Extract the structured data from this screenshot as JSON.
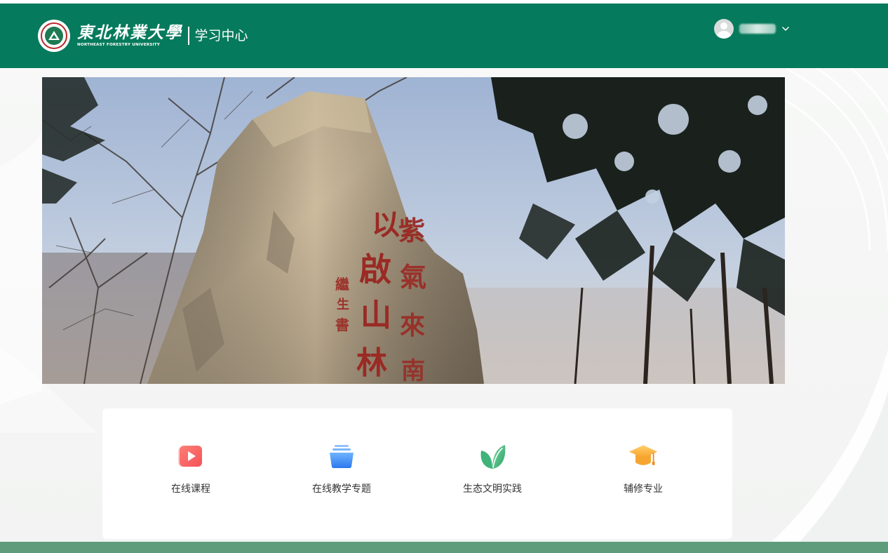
{
  "header": {
    "logo_cn": "東北林業大學",
    "logo_en": "NORTHEAST FORESTRY UNIVERSITY",
    "subtitle": "学习中心",
    "bg_color": "#067a5c"
  },
  "user": {
    "avatar_icon": "user-avatar-icon",
    "menu_icon": "chevron-down-icon"
  },
  "banner": {
    "carving_main": [
      "以",
      "啟",
      "山",
      "林"
    ],
    "carving_side": [
      "紫",
      "氣",
      "來",
      "南"
    ],
    "carving_sign": [
      "繼",
      "生",
      "書"
    ]
  },
  "nav": {
    "items": [
      {
        "label": "在线课程",
        "icon": "play-video-icon",
        "color": "#f5595a"
      },
      {
        "label": "在线教学专题",
        "icon": "stacked-folder-icon",
        "color": "#3d8ef5"
      },
      {
        "label": "生态文明实践",
        "icon": "leaf-icon",
        "color": "#3eb57a"
      },
      {
        "label": "辅修专业",
        "icon": "graduation-cap-icon",
        "color": "#f9b03c"
      }
    ]
  },
  "footer": {
    "bg_color": "#5e9c7c"
  }
}
